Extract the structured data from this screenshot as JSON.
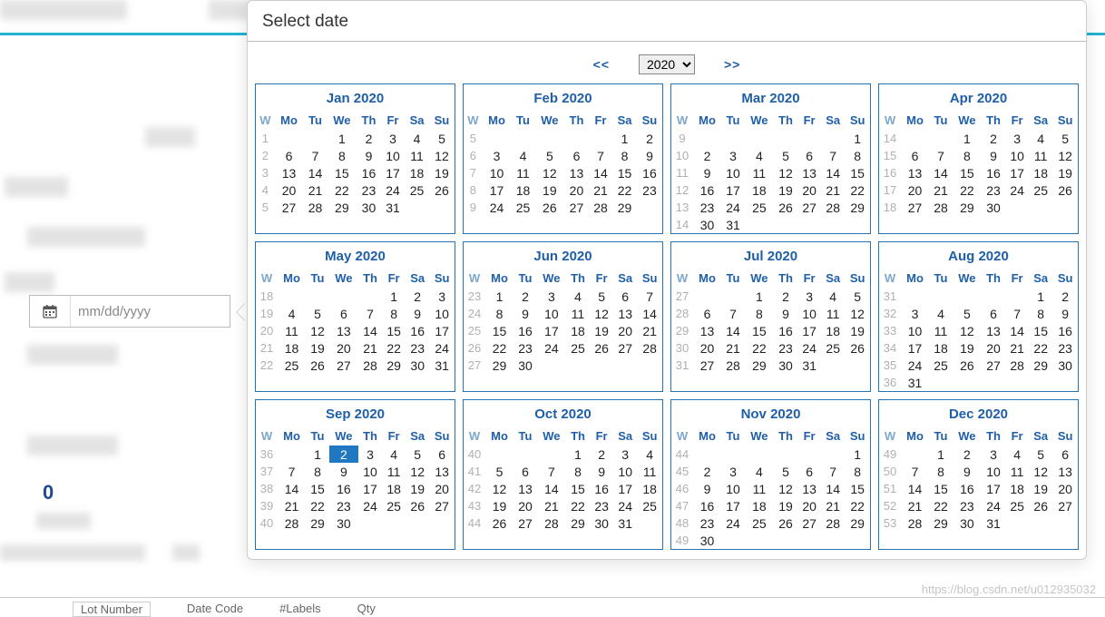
{
  "header": {
    "select_date": "Select date"
  },
  "input": {
    "placeholder": "mm/dd/yyyy"
  },
  "sidebar": {
    "zero": "0"
  },
  "nav": {
    "prev": "<<",
    "next": ">>",
    "year": "2020"
  },
  "selected_date": {
    "year": 2020,
    "month": 9,
    "day": 2
  },
  "day_headers": [
    "W",
    "Mo",
    "Tu",
    "We",
    "Th",
    "Fr",
    "Sa",
    "Su"
  ],
  "months": [
    {
      "title": "Jan 2020",
      "weeks": [
        {
          "w": "1",
          "d": [
            "",
            "",
            "1",
            "2",
            "3",
            "4",
            "5"
          ]
        },
        {
          "w": "2",
          "d": [
            "6",
            "7",
            "8",
            "9",
            "10",
            "11",
            "12"
          ]
        },
        {
          "w": "3",
          "d": [
            "13",
            "14",
            "15",
            "16",
            "17",
            "18",
            "19"
          ]
        },
        {
          "w": "4",
          "d": [
            "20",
            "21",
            "22",
            "23",
            "24",
            "25",
            "26"
          ]
        },
        {
          "w": "5",
          "d": [
            "27",
            "28",
            "29",
            "30",
            "31",
            "",
            ""
          ]
        }
      ]
    },
    {
      "title": "Feb 2020",
      "weeks": [
        {
          "w": "5",
          "d": [
            "",
            "",
            "",
            "",
            "",
            "1",
            "2"
          ]
        },
        {
          "w": "6",
          "d": [
            "3",
            "4",
            "5",
            "6",
            "7",
            "8",
            "9"
          ]
        },
        {
          "w": "7",
          "d": [
            "10",
            "11",
            "12",
            "13",
            "14",
            "15",
            "16"
          ]
        },
        {
          "w": "8",
          "d": [
            "17",
            "18",
            "19",
            "20",
            "21",
            "22",
            "23"
          ]
        },
        {
          "w": "9",
          "d": [
            "24",
            "25",
            "26",
            "27",
            "28",
            "29",
            ""
          ]
        }
      ]
    },
    {
      "title": "Mar 2020",
      "weeks": [
        {
          "w": "9",
          "d": [
            "",
            "",
            "",
            "",
            "",
            "",
            "1"
          ]
        },
        {
          "w": "10",
          "d": [
            "2",
            "3",
            "4",
            "5",
            "6",
            "7",
            "8"
          ]
        },
        {
          "w": "11",
          "d": [
            "9",
            "10",
            "11",
            "12",
            "13",
            "14",
            "15"
          ]
        },
        {
          "w": "12",
          "d": [
            "16",
            "17",
            "18",
            "19",
            "20",
            "21",
            "22"
          ]
        },
        {
          "w": "13",
          "d": [
            "23",
            "24",
            "25",
            "26",
            "27",
            "28",
            "29"
          ]
        },
        {
          "w": "14",
          "d": [
            "30",
            "31",
            "",
            "",
            "",
            "",
            ""
          ]
        }
      ]
    },
    {
      "title": "Apr 2020",
      "weeks": [
        {
          "w": "14",
          "d": [
            "",
            "",
            "1",
            "2",
            "3",
            "4",
            "5"
          ]
        },
        {
          "w": "15",
          "d": [
            "6",
            "7",
            "8",
            "9",
            "10",
            "11",
            "12"
          ]
        },
        {
          "w": "16",
          "d": [
            "13",
            "14",
            "15",
            "16",
            "17",
            "18",
            "19"
          ]
        },
        {
          "w": "17",
          "d": [
            "20",
            "21",
            "22",
            "23",
            "24",
            "25",
            "26"
          ]
        },
        {
          "w": "18",
          "d": [
            "27",
            "28",
            "29",
            "30",
            "",
            "",
            ""
          ]
        }
      ]
    },
    {
      "title": "May 2020",
      "weeks": [
        {
          "w": "18",
          "d": [
            "",
            "",
            "",
            "",
            "1",
            "2",
            "3"
          ]
        },
        {
          "w": "19",
          "d": [
            "4",
            "5",
            "6",
            "7",
            "8",
            "9",
            "10"
          ]
        },
        {
          "w": "20",
          "d": [
            "11",
            "12",
            "13",
            "14",
            "15",
            "16",
            "17"
          ]
        },
        {
          "w": "21",
          "d": [
            "18",
            "19",
            "20",
            "21",
            "22",
            "23",
            "24"
          ]
        },
        {
          "w": "22",
          "d": [
            "25",
            "26",
            "27",
            "28",
            "29",
            "30",
            "31"
          ]
        }
      ]
    },
    {
      "title": "Jun 2020",
      "weeks": [
        {
          "w": "23",
          "d": [
            "1",
            "2",
            "3",
            "4",
            "5",
            "6",
            "7"
          ]
        },
        {
          "w": "24",
          "d": [
            "8",
            "9",
            "10",
            "11",
            "12",
            "13",
            "14"
          ]
        },
        {
          "w": "25",
          "d": [
            "15",
            "16",
            "17",
            "18",
            "19",
            "20",
            "21"
          ]
        },
        {
          "w": "26",
          "d": [
            "22",
            "23",
            "24",
            "25",
            "26",
            "27",
            "28"
          ]
        },
        {
          "w": "27",
          "d": [
            "29",
            "30",
            "",
            "",
            "",
            "",
            ""
          ]
        }
      ]
    },
    {
      "title": "Jul 2020",
      "weeks": [
        {
          "w": "27",
          "d": [
            "",
            "",
            "1",
            "2",
            "3",
            "4",
            "5"
          ]
        },
        {
          "w": "28",
          "d": [
            "6",
            "7",
            "8",
            "9",
            "10",
            "11",
            "12"
          ]
        },
        {
          "w": "29",
          "d": [
            "13",
            "14",
            "15",
            "16",
            "17",
            "18",
            "19"
          ]
        },
        {
          "w": "30",
          "d": [
            "20",
            "21",
            "22",
            "23",
            "24",
            "25",
            "26"
          ]
        },
        {
          "w": "31",
          "d": [
            "27",
            "28",
            "29",
            "30",
            "31",
            "",
            ""
          ]
        }
      ]
    },
    {
      "title": "Aug 2020",
      "weeks": [
        {
          "w": "31",
          "d": [
            "",
            "",
            "",
            "",
            "",
            "1",
            "2"
          ]
        },
        {
          "w": "32",
          "d": [
            "3",
            "4",
            "5",
            "6",
            "7",
            "8",
            "9"
          ]
        },
        {
          "w": "33",
          "d": [
            "10",
            "11",
            "12",
            "13",
            "14",
            "15",
            "16"
          ]
        },
        {
          "w": "34",
          "d": [
            "17",
            "18",
            "19",
            "20",
            "21",
            "22",
            "23"
          ]
        },
        {
          "w": "35",
          "d": [
            "24",
            "25",
            "26",
            "27",
            "28",
            "29",
            "30"
          ]
        },
        {
          "w": "36",
          "d": [
            "31",
            "",
            "",
            "",
            "",
            "",
            ""
          ]
        }
      ]
    },
    {
      "title": "Sep 2020",
      "weeks": [
        {
          "w": "36",
          "d": [
            "",
            "1",
            "2",
            "3",
            "4",
            "5",
            "6"
          ]
        },
        {
          "w": "37",
          "d": [
            "7",
            "8",
            "9",
            "10",
            "11",
            "12",
            "13"
          ]
        },
        {
          "w": "38",
          "d": [
            "14",
            "15",
            "16",
            "17",
            "18",
            "19",
            "20"
          ]
        },
        {
          "w": "39",
          "d": [
            "21",
            "22",
            "23",
            "24",
            "25",
            "26",
            "27"
          ]
        },
        {
          "w": "40",
          "d": [
            "28",
            "29",
            "30",
            "",
            "",
            "",
            ""
          ]
        }
      ]
    },
    {
      "title": "Oct 2020",
      "weeks": [
        {
          "w": "40",
          "d": [
            "",
            "",
            "",
            "1",
            "2",
            "3",
            "4"
          ]
        },
        {
          "w": "41",
          "d": [
            "5",
            "6",
            "7",
            "8",
            "9",
            "10",
            "11"
          ]
        },
        {
          "w": "42",
          "d": [
            "12",
            "13",
            "14",
            "15",
            "16",
            "17",
            "18"
          ]
        },
        {
          "w": "43",
          "d": [
            "19",
            "20",
            "21",
            "22",
            "23",
            "24",
            "25"
          ]
        },
        {
          "w": "44",
          "d": [
            "26",
            "27",
            "28",
            "29",
            "30",
            "31",
            ""
          ]
        }
      ]
    },
    {
      "title": "Nov 2020",
      "weeks": [
        {
          "w": "44",
          "d": [
            "",
            "",
            "",
            "",
            "",
            "",
            "1"
          ]
        },
        {
          "w": "45",
          "d": [
            "2",
            "3",
            "4",
            "5",
            "6",
            "7",
            "8"
          ]
        },
        {
          "w": "46",
          "d": [
            "9",
            "10",
            "11",
            "12",
            "13",
            "14",
            "15"
          ]
        },
        {
          "w": "47",
          "d": [
            "16",
            "17",
            "18",
            "19",
            "20",
            "21",
            "22"
          ]
        },
        {
          "w": "48",
          "d": [
            "23",
            "24",
            "25",
            "26",
            "27",
            "28",
            "29"
          ]
        },
        {
          "w": "49",
          "d": [
            "30",
            "",
            "",
            "",
            "",
            "",
            ""
          ]
        }
      ]
    },
    {
      "title": "Dec 2020",
      "weeks": [
        {
          "w": "49",
          "d": [
            "",
            "1",
            "2",
            "3",
            "4",
            "5",
            "6"
          ]
        },
        {
          "w": "50",
          "d": [
            "7",
            "8",
            "9",
            "10",
            "11",
            "12",
            "13"
          ]
        },
        {
          "w": "51",
          "d": [
            "14",
            "15",
            "16",
            "17",
            "18",
            "19",
            "20"
          ]
        },
        {
          "w": "52",
          "d": [
            "21",
            "22",
            "23",
            "24",
            "25",
            "26",
            "27"
          ]
        },
        {
          "w": "53",
          "d": [
            "28",
            "29",
            "30",
            "31",
            "",
            "",
            ""
          ]
        }
      ]
    }
  ],
  "bottom": {
    "lot": "Lot Number",
    "datecode": "Date Code",
    "labels": "#Labels",
    "qty": "Qty"
  },
  "watermark": "https://blog.csdn.net/u012935032"
}
